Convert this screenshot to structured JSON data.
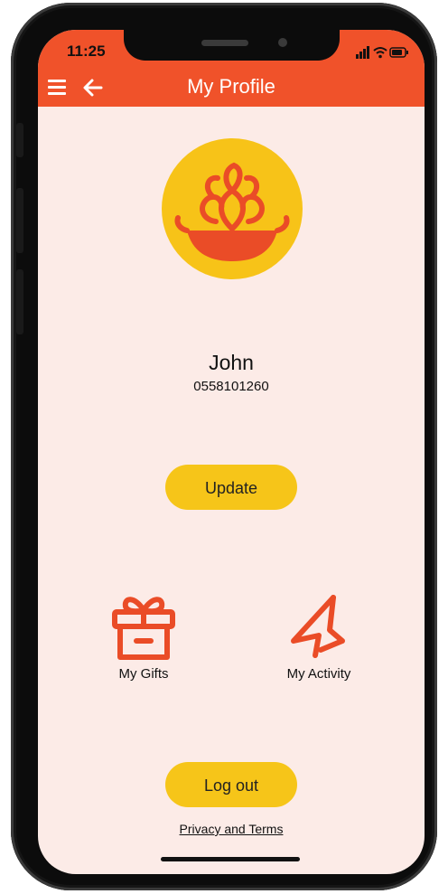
{
  "status_bar": {
    "time": "11:25"
  },
  "header": {
    "title": "My Profile"
  },
  "profile": {
    "name": "John",
    "phone": "0558101260"
  },
  "buttons": {
    "update_label": "Update",
    "logout_label": "Log out"
  },
  "tiles": [
    {
      "label": "My Gifts",
      "icon": "gift-icon"
    },
    {
      "label": "My Activity",
      "icon": "activity-icon"
    }
  ],
  "footer": {
    "privacy_label": "Privacy and Terms"
  },
  "colors": {
    "accent": "#f0522a",
    "button": "#f6c519",
    "background": "#fcebe7",
    "logo_bg": "#f7c318"
  }
}
